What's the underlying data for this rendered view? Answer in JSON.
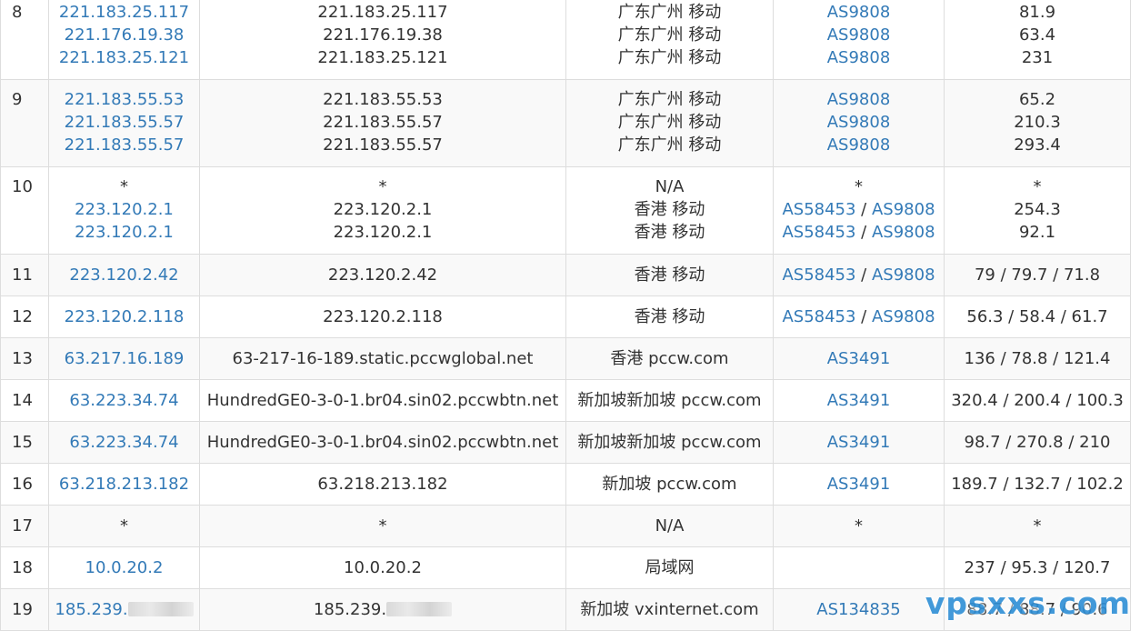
{
  "rows": [
    {
      "hop": "8",
      "alt": false,
      "ips": [
        "221.183.25.117",
        "221.176.19.38",
        "221.183.25.121"
      ],
      "hosts": [
        "221.183.25.117",
        "221.176.19.38",
        "221.183.25.121"
      ],
      "locs": [
        "广东广州 移动",
        "广东广州 移动",
        "广东广州 移动"
      ],
      "asns": [
        [
          "AS9808"
        ],
        [
          "AS9808"
        ],
        [
          "AS9808"
        ]
      ],
      "times": [
        "81.9",
        "63.4",
        "231"
      ]
    },
    {
      "hop": "9",
      "alt": true,
      "ips": [
        "221.183.55.53",
        "221.183.55.57",
        "221.183.55.57"
      ],
      "hosts": [
        "221.183.55.53",
        "221.183.55.57",
        "221.183.55.57"
      ],
      "locs": [
        "广东广州 移动",
        "广东广州 移动",
        "广东广州 移动"
      ],
      "asns": [
        [
          "AS9808"
        ],
        [
          "AS9808"
        ],
        [
          "AS9808"
        ]
      ],
      "times": [
        "65.2",
        "210.3",
        "293.4"
      ]
    },
    {
      "hop": "10",
      "alt": false,
      "ips": [
        "*",
        "223.120.2.1",
        "223.120.2.1"
      ],
      "hosts": [
        "*",
        "223.120.2.1",
        "223.120.2.1"
      ],
      "locs": [
        "N/A",
        "香港 移动",
        "香港 移动"
      ],
      "asns": [
        [
          "*"
        ],
        [
          "AS58453",
          "AS9808"
        ],
        [
          "AS58453",
          "AS9808"
        ]
      ],
      "times": [
        "*",
        "254.3",
        "92.1"
      ]
    },
    {
      "hop": "11",
      "alt": true,
      "ips": [
        "223.120.2.42"
      ],
      "hosts": [
        "223.120.2.42"
      ],
      "locs": [
        "香港 移动"
      ],
      "asns": [
        [
          "AS58453",
          "AS9808"
        ]
      ],
      "times": [
        "79 / 79.7 / 71.8"
      ]
    },
    {
      "hop": "12",
      "alt": false,
      "ips": [
        "223.120.2.118"
      ],
      "hosts": [
        "223.120.2.118"
      ],
      "locs": [
        "香港 移动"
      ],
      "asns": [
        [
          "AS58453",
          "AS9808"
        ]
      ],
      "times": [
        "56.3 / 58.4 / 61.7"
      ]
    },
    {
      "hop": "13",
      "alt": true,
      "ips": [
        "63.217.16.189"
      ],
      "hosts": [
        "63-217-16-189.static.pccwglobal.net"
      ],
      "locs": [
        "香港 pccw.com"
      ],
      "asns": [
        [
          "AS3491"
        ]
      ],
      "times": [
        "136 / 78.8 / 121.4"
      ]
    },
    {
      "hop": "14",
      "alt": false,
      "ips": [
        "63.223.34.74"
      ],
      "hosts": [
        "HundredGE0-3-0-1.br04.sin02.pccwbtn.net"
      ],
      "locs": [
        "新加坡新加坡 pccw.com"
      ],
      "asns": [
        [
          "AS3491"
        ]
      ],
      "times": [
        "320.4 / 200.4 / 100.3"
      ]
    },
    {
      "hop": "15",
      "alt": true,
      "ips": [
        "63.223.34.74"
      ],
      "hosts": [
        "HundredGE0-3-0-1.br04.sin02.pccwbtn.net"
      ],
      "locs": [
        "新加坡新加坡 pccw.com"
      ],
      "asns": [
        [
          "AS3491"
        ]
      ],
      "times": [
        "98.7 / 270.8 / 210"
      ]
    },
    {
      "hop": "16",
      "alt": false,
      "ips": [
        "63.218.213.182"
      ],
      "hosts": [
        "63.218.213.182"
      ],
      "locs": [
        "新加坡 pccw.com"
      ],
      "asns": [
        [
          "AS3491"
        ]
      ],
      "times": [
        "189.7 / 132.7 / 102.2"
      ]
    },
    {
      "hop": "17",
      "alt": true,
      "ips": [
        "*"
      ],
      "hosts": [
        "*"
      ],
      "locs": [
        "N/A"
      ],
      "asns": [
        [
          "*"
        ]
      ],
      "times": [
        "*"
      ]
    },
    {
      "hop": "18",
      "alt": false,
      "ips": [
        "10.0.20.2"
      ],
      "hosts": [
        "10.0.20.2"
      ],
      "locs": [
        "局域网"
      ],
      "asns": [
        []
      ],
      "times": [
        "237 / 95.3 / 120.7"
      ]
    },
    {
      "hop": "19",
      "alt": true,
      "ips": [
        "185.239."
      ],
      "hosts": [
        "185.239."
      ],
      "locs": [
        "新加坡 vxinternet.com"
      ],
      "asns": [
        [
          "AS134835"
        ]
      ],
      "times": [
        "88.7 / 88.7 / 90.6"
      ],
      "redacted": true
    }
  ],
  "watermark": "vpsxxs.com",
  "colors": {
    "link": "#337ab7",
    "border": "#dddddd",
    "alt_row": "#f9f9f9",
    "watermark": "#2f8fd6"
  }
}
